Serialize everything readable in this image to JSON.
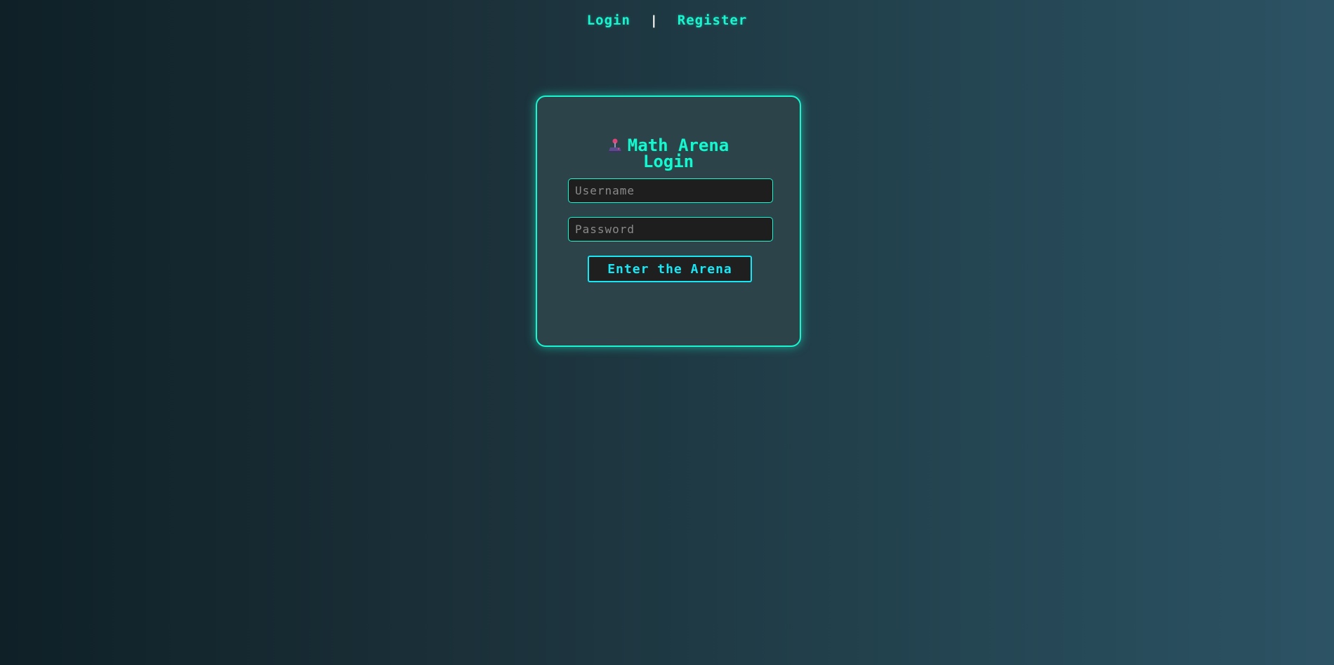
{
  "nav": {
    "login_label": "Login",
    "separator": "|",
    "register_label": "Register"
  },
  "login_card": {
    "title_line1": "Math Arena",
    "title_line2": "Login",
    "title_icon": "joystick-icon",
    "username": {
      "value": "",
      "placeholder": "Username"
    },
    "password": {
      "value": "",
      "placeholder": "Password"
    },
    "submit_label": "Enter the Arena"
  },
  "colors": {
    "accent": "#19f5cf",
    "button_accent": "#19e6f5",
    "card_bg": "#2c434a",
    "background_start": "#0f2027",
    "background_end": "#2c5364"
  }
}
